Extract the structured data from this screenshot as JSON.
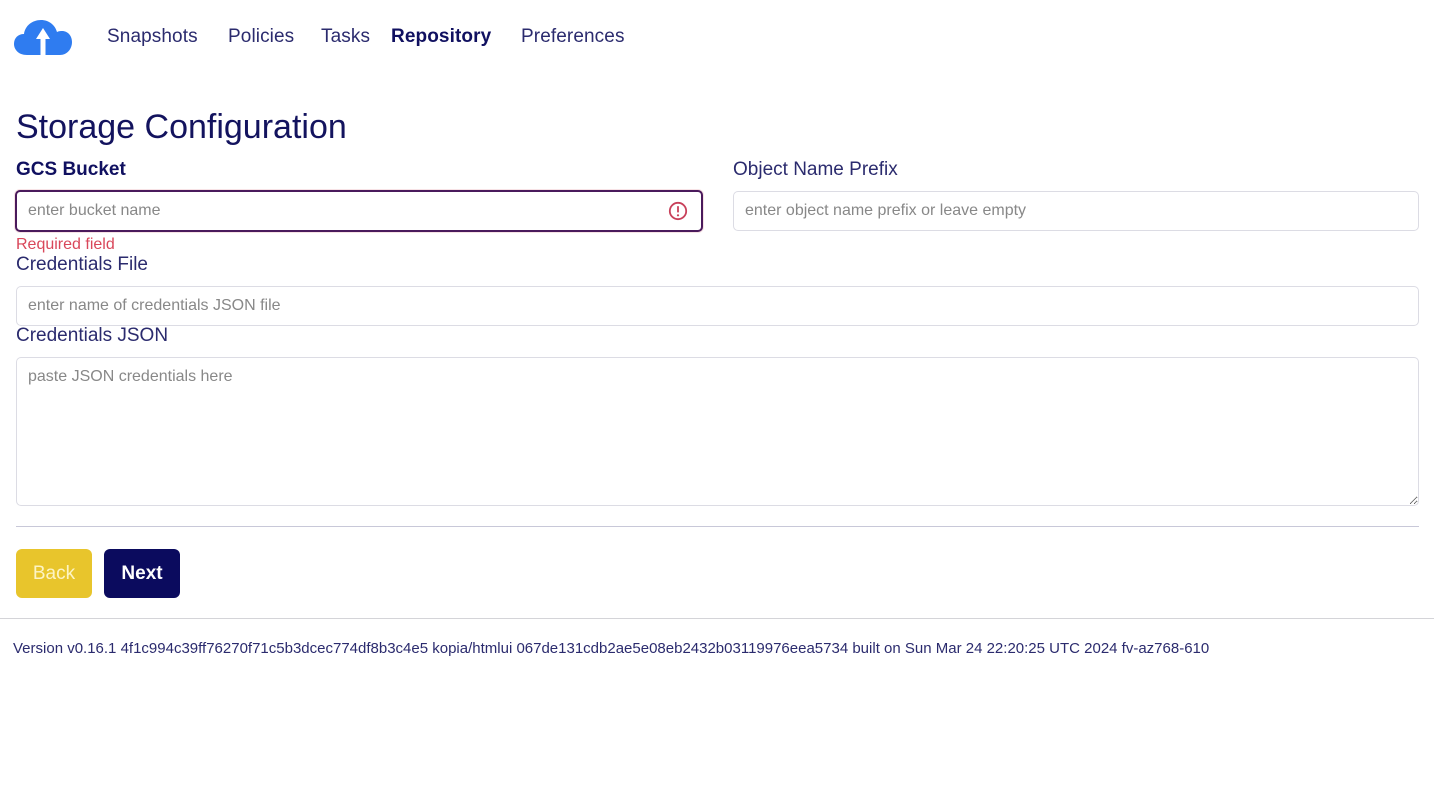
{
  "nav": {
    "logo_icon": "cloud-upload-icon",
    "items": [
      {
        "label": "Snapshots",
        "active": false
      },
      {
        "label": "Policies",
        "active": false
      },
      {
        "label": "Tasks",
        "active": false
      },
      {
        "label": "Repository",
        "active": true
      },
      {
        "label": "Preferences",
        "active": false
      }
    ]
  },
  "page": {
    "title": "Storage Configuration"
  },
  "form": {
    "bucket": {
      "label": "GCS Bucket",
      "value": "",
      "placeholder": "enter bucket name",
      "error": "Required field",
      "error_icon": "exclamation-circle-icon"
    },
    "prefix": {
      "label": "Object Name Prefix",
      "value": "",
      "placeholder": "enter object name prefix or leave empty"
    },
    "credentials_file": {
      "label": "Credentials File",
      "value": "",
      "placeholder": "enter name of credentials JSON file"
    },
    "credentials_json": {
      "label": "Credentials JSON",
      "value": "",
      "placeholder": "paste JSON credentials here"
    }
  },
  "buttons": {
    "back": "Back",
    "next": "Next"
  },
  "colors": {
    "back_button": "#e8c52c",
    "next_button": "#0b0b5e",
    "error": "#d9475a",
    "logo": "#2f7cf0"
  },
  "footer": {
    "version_text": "Version v0.16.1 4f1c994c39ff76270f71c5b3dcec774df8b3c4e5 kopia/htmlui 067de131cdb2ae5e08eb2432b03119976eea5734 built on Sun Mar 24 22:20:25 UTC 2024 fv-az768-610"
  }
}
